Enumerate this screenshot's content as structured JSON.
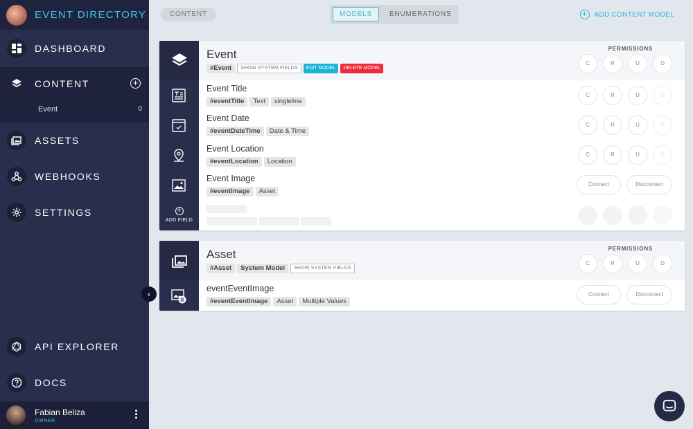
{
  "app": {
    "title": "EVENT DIRECTORY"
  },
  "sidebar": {
    "items": [
      {
        "label": "DASHBOARD",
        "icon": "dashboard-icon"
      },
      {
        "label": "CONTENT",
        "icon": "layers-icon"
      },
      {
        "label": "ASSETS",
        "icon": "image-icon"
      },
      {
        "label": "WEBHOOKS",
        "icon": "webhook-icon"
      },
      {
        "label": "SETTINGS",
        "icon": "gear-icon"
      },
      {
        "label": "API EXPLORER",
        "icon": "graphql-icon"
      },
      {
        "label": "DOCS",
        "icon": "help-icon"
      }
    ],
    "content_models": [
      {
        "label": "Event",
        "count": "0"
      }
    ],
    "user": {
      "name": "Fabian Beliza",
      "role": "OWNER"
    }
  },
  "topbar": {
    "content_pill": "CONTENT",
    "tabs": [
      {
        "label": "MODELS",
        "active": true
      },
      {
        "label": "ENUMERATIONS",
        "active": false
      }
    ],
    "add_model_label": "ADD CONTENT MODEL"
  },
  "models": [
    {
      "name": "Event",
      "api_id": "#Event",
      "show_system_fields": "SHOW SYSTEM FIELDS",
      "edit_label": "EDIT MODEL",
      "delete_label": "DELETE MODEL",
      "permissions_label": "PERMISSIONS",
      "permissions": [
        "C",
        "R",
        "U",
        "D"
      ],
      "fields": [
        {
          "name": "Event Title",
          "api_id": "#eventTitle",
          "tags": [
            "Text",
            "singleline"
          ],
          "icon": "text-field-icon"
        },
        {
          "name": "Event Date",
          "api_id": "#eventDateTime",
          "tags": [
            "Date & Time"
          ],
          "icon": "calendar-icon"
        },
        {
          "name": "Event Location",
          "api_id": "#eventLocation",
          "tags": [
            "Location"
          ],
          "icon": "location-pin-icon"
        },
        {
          "name": "Event Image",
          "api_id": "#eventImage",
          "tags": [
            "Asset"
          ],
          "icon": "image-field-icon",
          "actions": [
            "Connect",
            "Disconnect"
          ]
        }
      ],
      "add_field_label": "ADD FIELD"
    },
    {
      "name": "Asset",
      "api_id": "#Asset",
      "system_tag": "System Model",
      "show_system_fields": "SHOW SYSTEM FIELDS",
      "permissions_label": "PERMISSIONS",
      "permissions": [
        "C",
        "R",
        "U",
        "D"
      ],
      "fields": [
        {
          "name": "eventEventImage",
          "api_id": "#eventEventImage",
          "tags": [
            "Asset",
            "Multiple Values"
          ],
          "icon": "image-list-icon",
          "actions": [
            "Connect",
            "Disconnect"
          ]
        }
      ]
    }
  ]
}
